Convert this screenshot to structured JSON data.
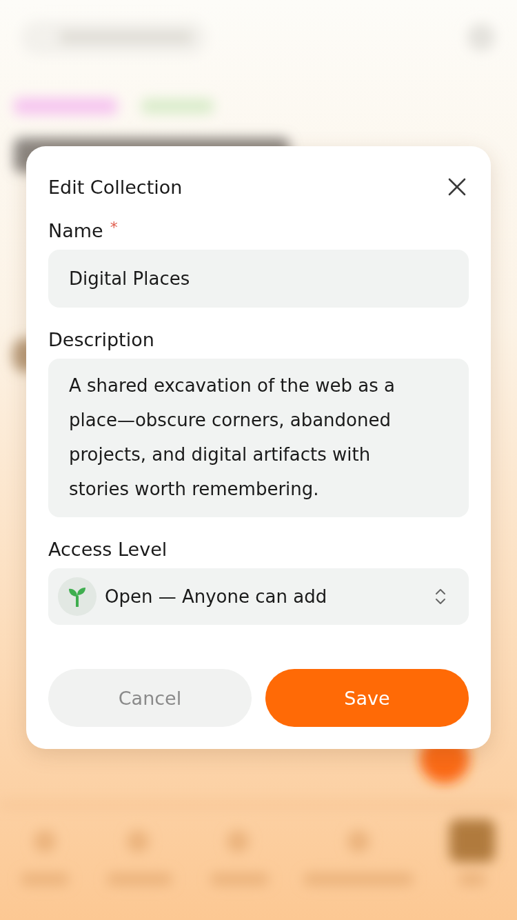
{
  "dialog": {
    "title": "Edit Collection",
    "fields": [
      {
        "kind": "text",
        "label": "Name",
        "required_mark": "*",
        "value": "Digital Places"
      },
      {
        "kind": "textarea",
        "label": "Description",
        "value": "A shared excavation of the web as a place—obscure corners, abandoned projects, and digital artifacts with stories worth remembering."
      },
      {
        "kind": "select",
        "label": "Access Level",
        "value": "Open — Anyone can add"
      }
    ],
    "buttons": [
      {
        "kind": "secondary",
        "label": "Cancel"
      },
      {
        "kind": "primary",
        "label": "Save"
      }
    ]
  }
}
